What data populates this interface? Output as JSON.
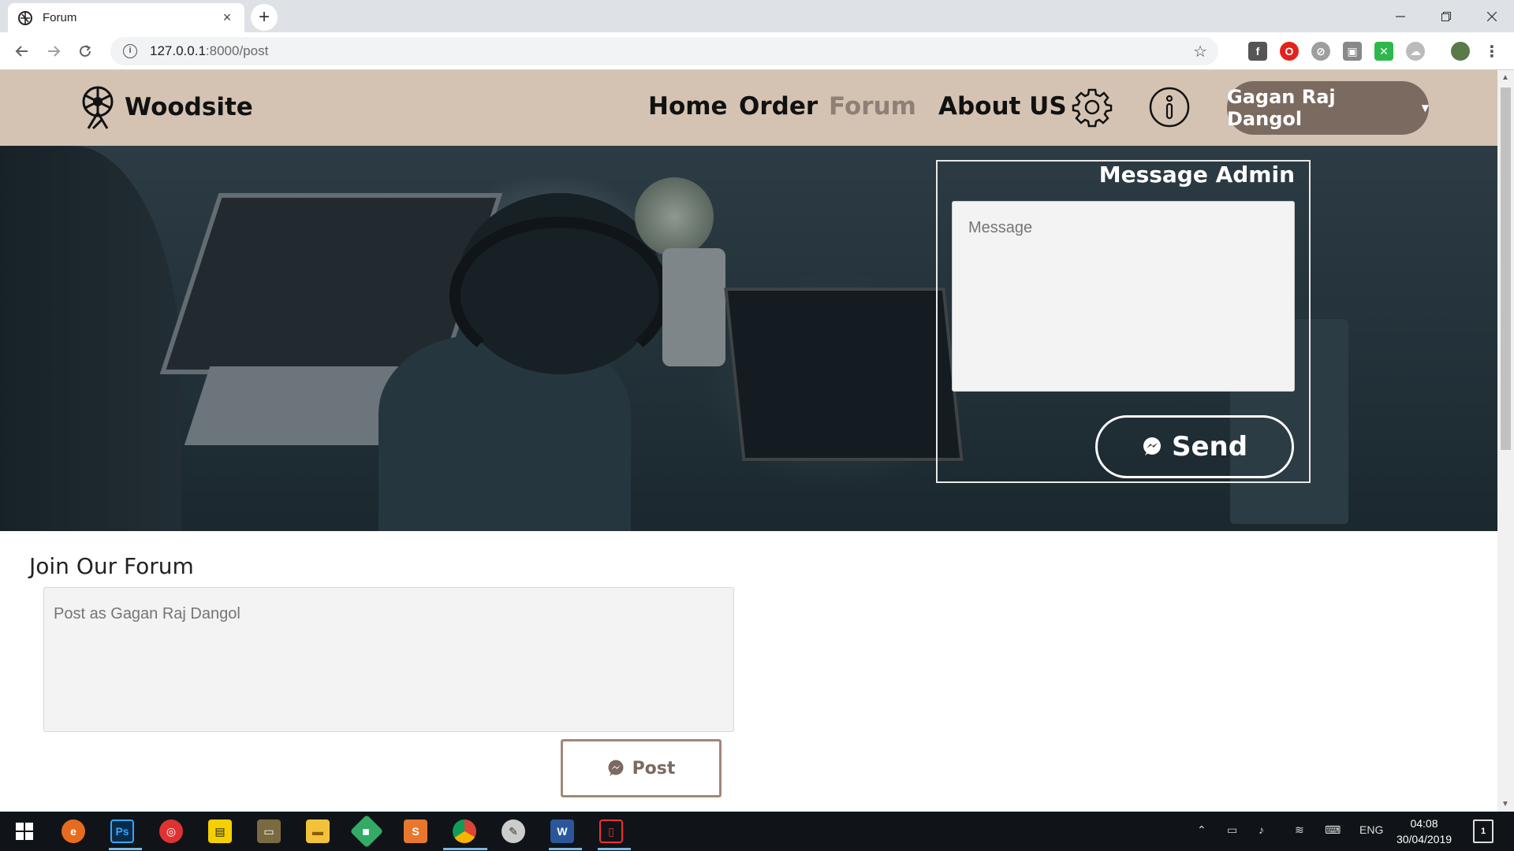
{
  "browser": {
    "tab_title": "Forum",
    "tab_close": "×",
    "new_tab": "+",
    "url_host": "127.0.0.1",
    "url_rest": ":8000/post",
    "star": "☆"
  },
  "site": {
    "brand": "Woodsite",
    "nav": {
      "home": "Home",
      "order": "Order",
      "forum": "Forum",
      "about": "About US"
    },
    "user_name": "Gagan Raj Dangol",
    "caret": "▼"
  },
  "message_admin": {
    "title": "Message Admin",
    "placeholder": "Message",
    "send_label": "Send"
  },
  "forum": {
    "title": "Join Our Forum",
    "placeholder": "Post as Gagan Raj Dangol",
    "post_label": "Post"
  },
  "taskbar": {
    "lang": "ENG",
    "time": "04:08",
    "date": "30/04/2019",
    "notification_count": "1"
  },
  "colors": {
    "header_bg": "#d4c3b2",
    "user_button": "#7a6a60",
    "nav_active": "#8e8076",
    "post_border": "#a08878"
  }
}
